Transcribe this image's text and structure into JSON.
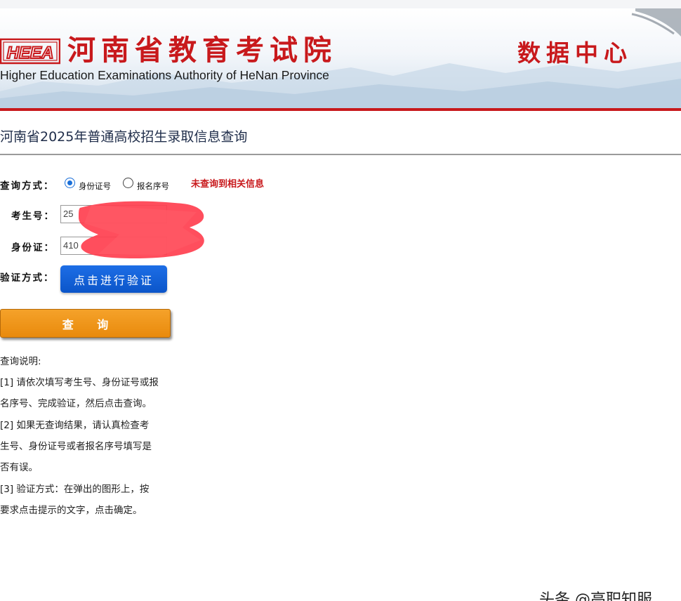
{
  "header": {
    "logo_text": "HEEA",
    "site_name": "河南省教育考试院",
    "site_name_en": "Higher Education Examinations Authority of HeNan Province",
    "section": "数据中心",
    "accent_color": "#c8191c"
  },
  "page": {
    "title": "河南省2025年普通高校招生录取信息查询"
  },
  "form": {
    "query_mode_label": "查询方式：",
    "query_modes": [
      {
        "label": "身份证号",
        "selected": true
      },
      {
        "label": "报名序号",
        "selected": false
      }
    ],
    "error_message": "未查询到相关信息",
    "exam_no_label": "考生号：",
    "exam_no_value": "25",
    "id_label": "身份证：",
    "id_value": "410",
    "verify_label": "验证方式：",
    "verify_button": "点击进行验证",
    "query_button": "查 询"
  },
  "instructions": {
    "title": "查询说明:",
    "lines": [
      "[1] 请依次填写考生号、身份证号或报",
      "名序号、完成验证，然后点击查询。",
      "[2] 如果无查询结果，请认真检查考",
      "生号、身份证号或者报名序号填写是",
      "否有误。",
      "[3] 验证方式：在弹出的图形上，按",
      "要求点击提示的文字，点击确定。"
    ]
  },
  "watermark": "头条 @高职知服"
}
